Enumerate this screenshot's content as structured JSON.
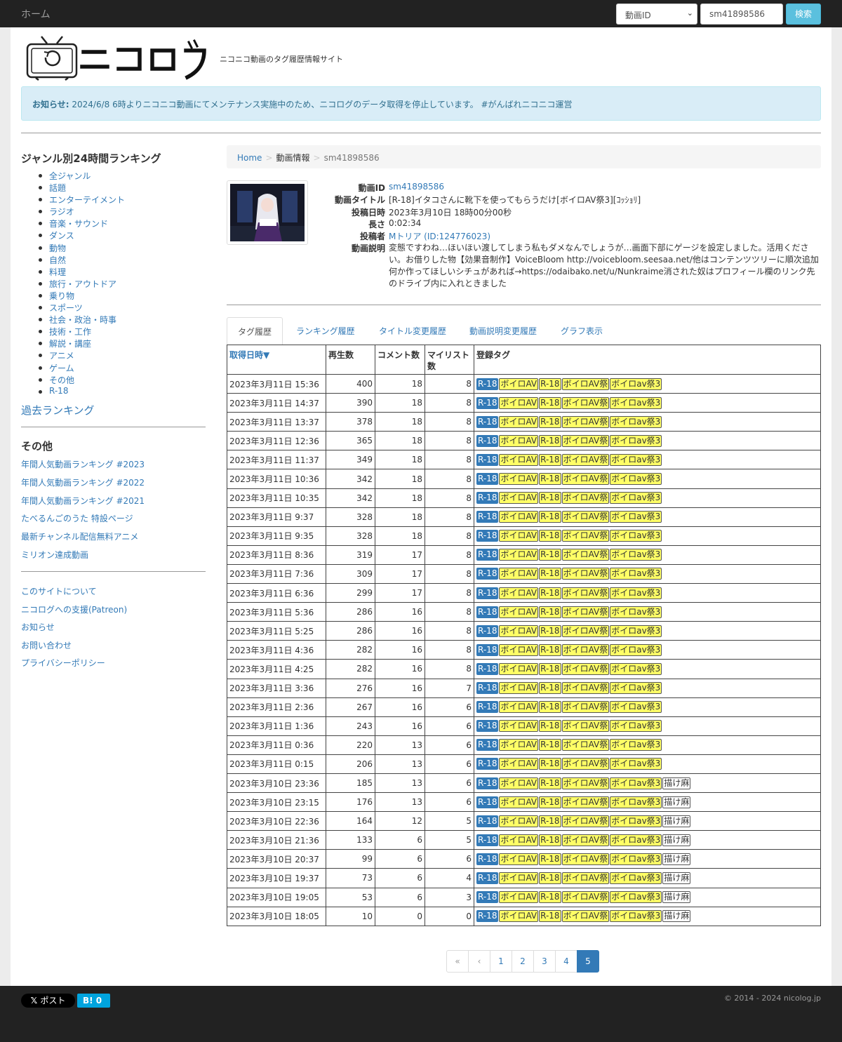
{
  "nav": {
    "home": "ホーム"
  },
  "search": {
    "type": "動画ID",
    "value": "sm41898586",
    "button": "検索"
  },
  "tagline": "ニコニコ動画のタグ履歴情報サイト",
  "notice": {
    "label": "お知らせ:",
    "text": " 2024/6/8 6時よりニコニコ動画にてメンテナンス実施中のため、ニコログのデータ取得を停止しています。 #がんばれニコニコ運営"
  },
  "sidebar": {
    "genre_title": "ジャンル別24時間ランキング",
    "genres": [
      "全ジャンル",
      "話題",
      "エンターテイメント",
      "ラジオ",
      "音楽・サウンド",
      "ダンス",
      "動物",
      "自然",
      "料理",
      "旅行・アウトドア",
      "乗り物",
      "スポーツ",
      "社会・政治・時事",
      "技術・工作",
      "解説・講座",
      "アニメ",
      "ゲーム",
      "その他",
      "R-18"
    ],
    "past_ranking": "過去ランキング",
    "other_title": "その他",
    "other_links": [
      "年間人気動画ランキング #2023",
      "年間人気動画ランキング #2022",
      "年間人気動画ランキング #2021",
      "たべるんごのうた 特設ページ",
      "最新チャンネル配信無料アニメ",
      "ミリオン達成動画"
    ],
    "site_links": [
      "このサイトについて",
      "ニコログへの支援(Patreon)",
      "お知らせ",
      "お問い合わせ",
      "プライバシーポリシー"
    ]
  },
  "breadcrumb": {
    "home": "Home",
    "info": "動画情報",
    "current": "sm41898586"
  },
  "info": {
    "id_label": "動画ID",
    "id": "sm41898586",
    "title_label": "動画タイトル",
    "title": "[R-18]イタコさんに靴下を使ってもらうだけ[ボイロAV祭3][ｺｯｼｮﾘ]",
    "posted_label": "投稿日時",
    "posted": "2023年3月10日 18時00分00秒",
    "length_label": "長さ",
    "length": "0:02:34",
    "author_label": "投稿者",
    "author": "Mトリア (ID:124776023)",
    "desc_label": "動画説明",
    "desc": "変態ですわね…ほいほい渡してしまう私もダメなんでしょうが…画面下部にゲージを設定しました。活用ください。お借りした物【効果音制作】VoiceBloom http://voicebloom.seesaa.net/他はコンテンツツリーに順次追加何か作ってほしいシチュがあれば→https://odaibako.net/u/Nunkraime消された奴はプロフィール欄のリンク先のドライブ内に入れときました"
  },
  "tabs": [
    "タグ履歴",
    "ランキング履歴",
    "タイトル変更履歴",
    "動画説明変更履歴",
    "グラフ表示"
  ],
  "table": {
    "headers": [
      "取得日時▼",
      "再生数",
      "コメント数",
      "マイリスト数",
      "登録タグ"
    ],
    "rows": [
      [
        "2023年3月11日 15:36",
        "400",
        "18",
        "8"
      ],
      [
        "2023年3月11日 14:37",
        "390",
        "18",
        "8"
      ],
      [
        "2023年3月11日 13:37",
        "378",
        "18",
        "8"
      ],
      [
        "2023年3月11日 12:36",
        "365",
        "18",
        "8"
      ],
      [
        "2023年3月11日 11:37",
        "349",
        "18",
        "8"
      ],
      [
        "2023年3月11日 10:36",
        "342",
        "18",
        "8"
      ],
      [
        "2023年3月11日 10:35",
        "342",
        "18",
        "8"
      ],
      [
        "2023年3月11日 9:37",
        "328",
        "18",
        "8"
      ],
      [
        "2023年3月11日 9:35",
        "328",
        "18",
        "8"
      ],
      [
        "2023年3月11日 8:36",
        "319",
        "17",
        "8"
      ],
      [
        "2023年3月11日 7:36",
        "309",
        "17",
        "8"
      ],
      [
        "2023年3月11日 6:36",
        "299",
        "17",
        "8"
      ],
      [
        "2023年3月11日 5:36",
        "286",
        "16",
        "8"
      ],
      [
        "2023年3月11日 5:25",
        "286",
        "16",
        "8"
      ],
      [
        "2023年3月11日 4:36",
        "282",
        "16",
        "8"
      ],
      [
        "2023年3月11日 4:25",
        "282",
        "16",
        "8"
      ],
      [
        "2023年3月11日 3:36",
        "276",
        "16",
        "7"
      ],
      [
        "2023年3月11日 2:36",
        "267",
        "16",
        "6"
      ],
      [
        "2023年3月11日 1:36",
        "243",
        "16",
        "6"
      ],
      [
        "2023年3月11日 0:36",
        "220",
        "13",
        "6"
      ],
      [
        "2023年3月11日 0:15",
        "206",
        "13",
        "6"
      ],
      [
        "2023年3月10日 23:36",
        "185",
        "13",
        "6"
      ],
      [
        "2023年3月10日 23:15",
        "176",
        "13",
        "6"
      ],
      [
        "2023年3月10日 22:36",
        "164",
        "12",
        "5"
      ],
      [
        "2023年3月10日 21:36",
        "133",
        "6",
        "5"
      ],
      [
        "2023年3月10日 20:37",
        "99",
        "6",
        "6"
      ],
      [
        "2023年3月10日 19:37",
        "73",
        "6",
        "4"
      ],
      [
        "2023年3月10日 19:05",
        "53",
        "6",
        "3"
      ],
      [
        "2023年3月10日 18:05",
        "10",
        "0",
        "0"
      ]
    ],
    "tags_base": [
      "R-18",
      "ボイロAV",
      "R-18",
      "ボイロAV祭",
      "ボイロav祭3"
    ],
    "tags_extra": "描け麻",
    "extra_from_row": 21
  },
  "pagination": [
    "«",
    "‹",
    "1",
    "2",
    "3",
    "4",
    "5"
  ],
  "footer": {
    "x_post": "ポスト",
    "hatena": "B! 0",
    "copyright": "© 2014 - 2024 nicolog.jp"
  },
  "colors": {
    "link": "#337ab7",
    "tag_yellow": "#ffff66",
    "tag_r18": "#337ab7",
    "navbar": "#222222",
    "notice_bg": "#d9edf7"
  }
}
